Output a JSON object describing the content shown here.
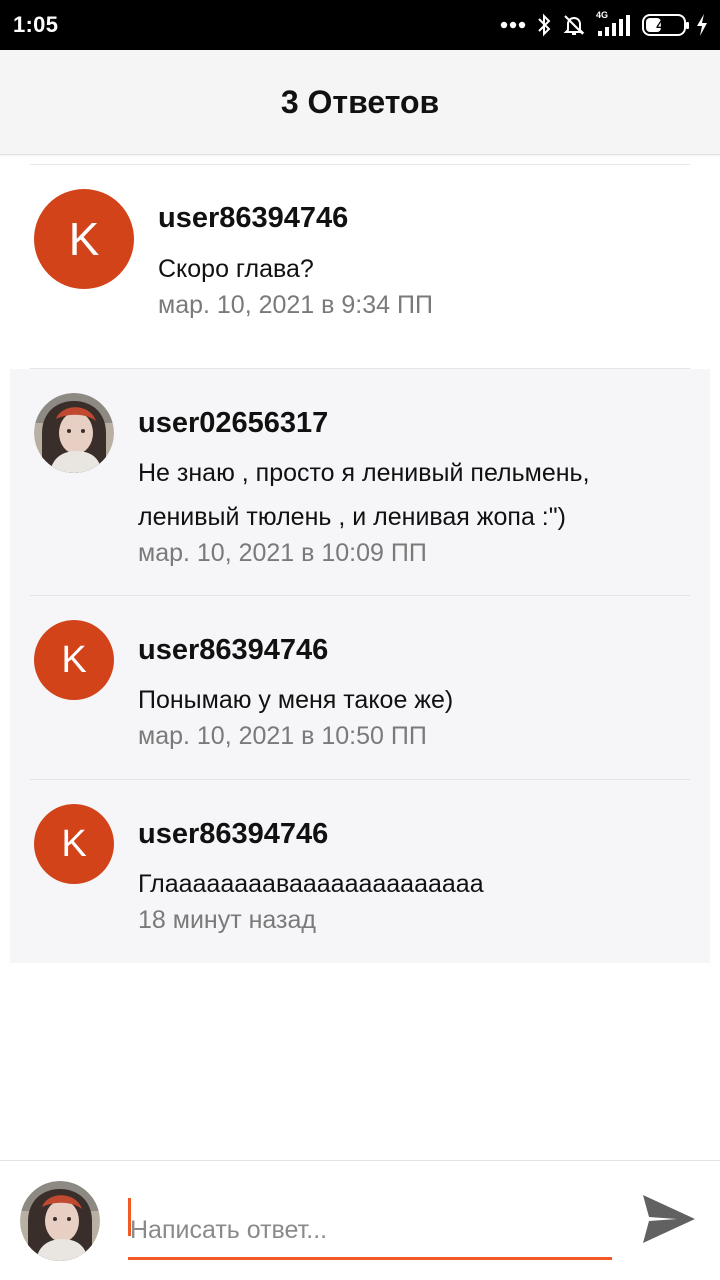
{
  "status_bar": {
    "time": "1:05",
    "network": "4G",
    "battery": "43",
    "battery_level": 0.43
  },
  "header": {
    "title": "3 Ответов"
  },
  "main_comment": {
    "avatar_letter": "K",
    "avatar_color": "#d2431a",
    "username": "user86394746",
    "text": "Скоро глава?",
    "timestamp": "мар. 10, 2021 в 9:34 ПП"
  },
  "replies": [
    {
      "avatar_type": "photo",
      "username": "user02656317",
      "text_lines": [
        "Не знаю , просто я ленивый пельмень,",
        "ленивый тюлень , и ленивая жопа :\")"
      ],
      "timestamp": "мар. 10, 2021 в 10:09 ПП"
    },
    {
      "avatar_type": "letter",
      "avatar_letter": "K",
      "username": "user86394746",
      "text_lines": [
        "Понымаю у меня такое же)"
      ],
      "timestamp": "мар. 10, 2021 в 10:50 ПП"
    },
    {
      "avatar_type": "letter",
      "avatar_letter": "K",
      "username": "user86394746",
      "text_lines": [
        "Глааааааааваааааааааааааа"
      ],
      "timestamp": "18 минут назад"
    }
  ],
  "composer": {
    "placeholder": "Написать ответ...",
    "value": ""
  },
  "colors": {
    "accent": "#f15a24",
    "avatar": "#d2431a",
    "reply_background": "#f6f5f8",
    "timestamp": "#7a7a7a"
  },
  "icons": {
    "send": "send-icon",
    "bluetooth": "bluetooth-icon",
    "silent": "bell-off-icon",
    "signal": "signal-icon",
    "more": "more-dots-icon",
    "charging": "charging-bolt-icon"
  }
}
